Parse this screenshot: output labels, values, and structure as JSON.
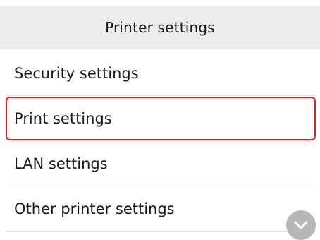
{
  "header": {
    "title": "Printer settings"
  },
  "menu": {
    "items": [
      {
        "label": "Security settings"
      },
      {
        "label": "Print settings"
      },
      {
        "label": "LAN settings"
      },
      {
        "label": "Other printer settings"
      }
    ],
    "selected_index": 1,
    "selection_color": "#e02020"
  },
  "scroll": {
    "icon": "chevron-down-icon"
  }
}
